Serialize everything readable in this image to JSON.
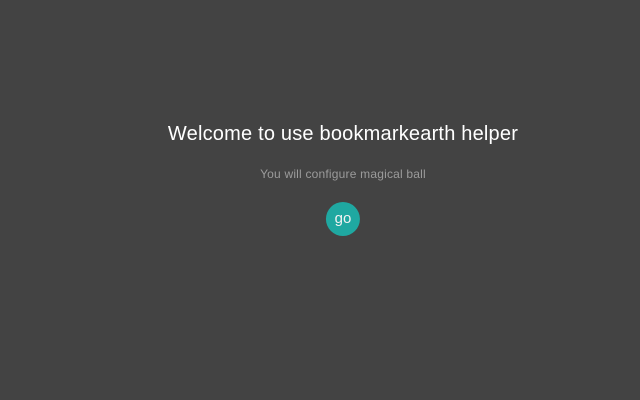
{
  "page": {
    "background_color": "#434343",
    "heading": "Welcome to use bookmarkearth helper",
    "subtitle": "You will configure magical ball",
    "go_button": {
      "label": "go",
      "color": "#1fa8a1",
      "text_color": "#f2f2f2"
    },
    "colors": {
      "heading_text": "#ffffff",
      "subtitle_text": "#9b9b9b"
    }
  }
}
